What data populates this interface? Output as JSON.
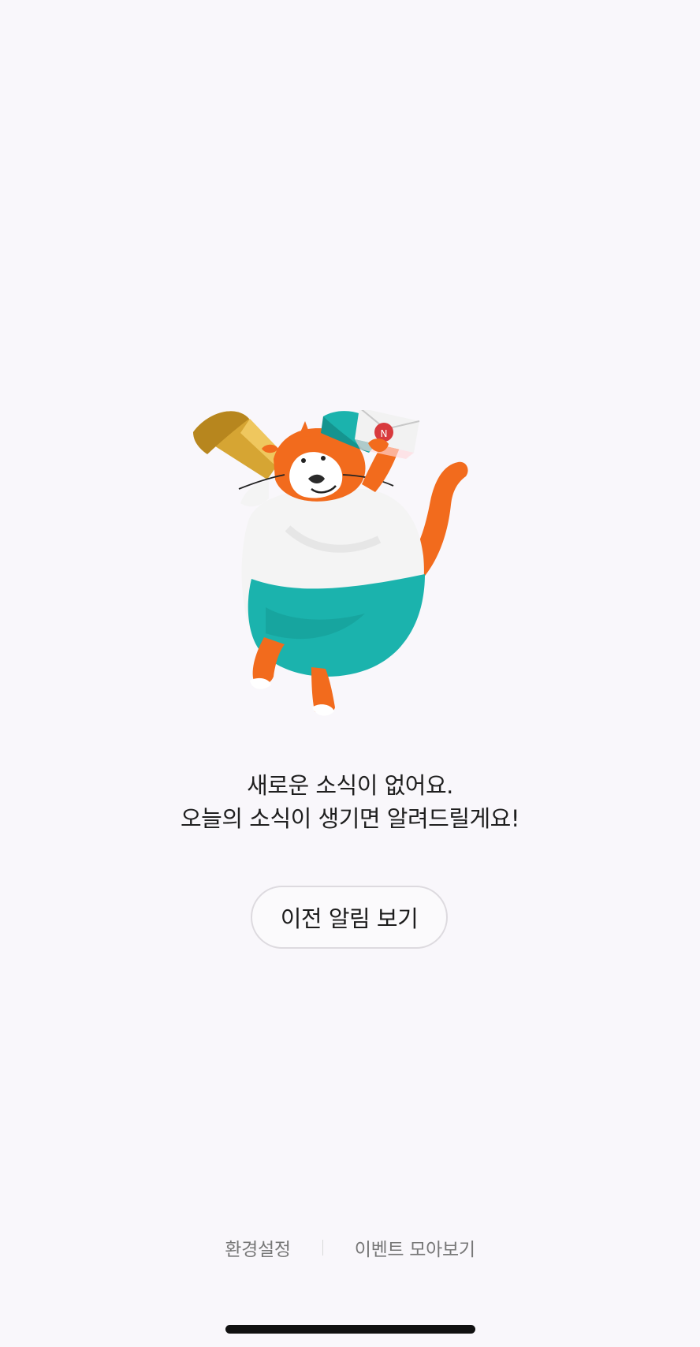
{
  "empty_state": {
    "illustration": "cat-with-megaphone-and-envelope",
    "line1": "새로운 소식이 없어요.",
    "line2": "오늘의 소식이 생기면 알려드릴게요!"
  },
  "actions": {
    "history_button": "이전 알림 보기"
  },
  "footer": {
    "settings": "환경설정",
    "events": "이벤트 모아보기"
  },
  "colors": {
    "background": "#f9f7fb",
    "cat_orange": "#f26b1d",
    "teal": "#1bb3ad",
    "gold": "#d6a533"
  }
}
